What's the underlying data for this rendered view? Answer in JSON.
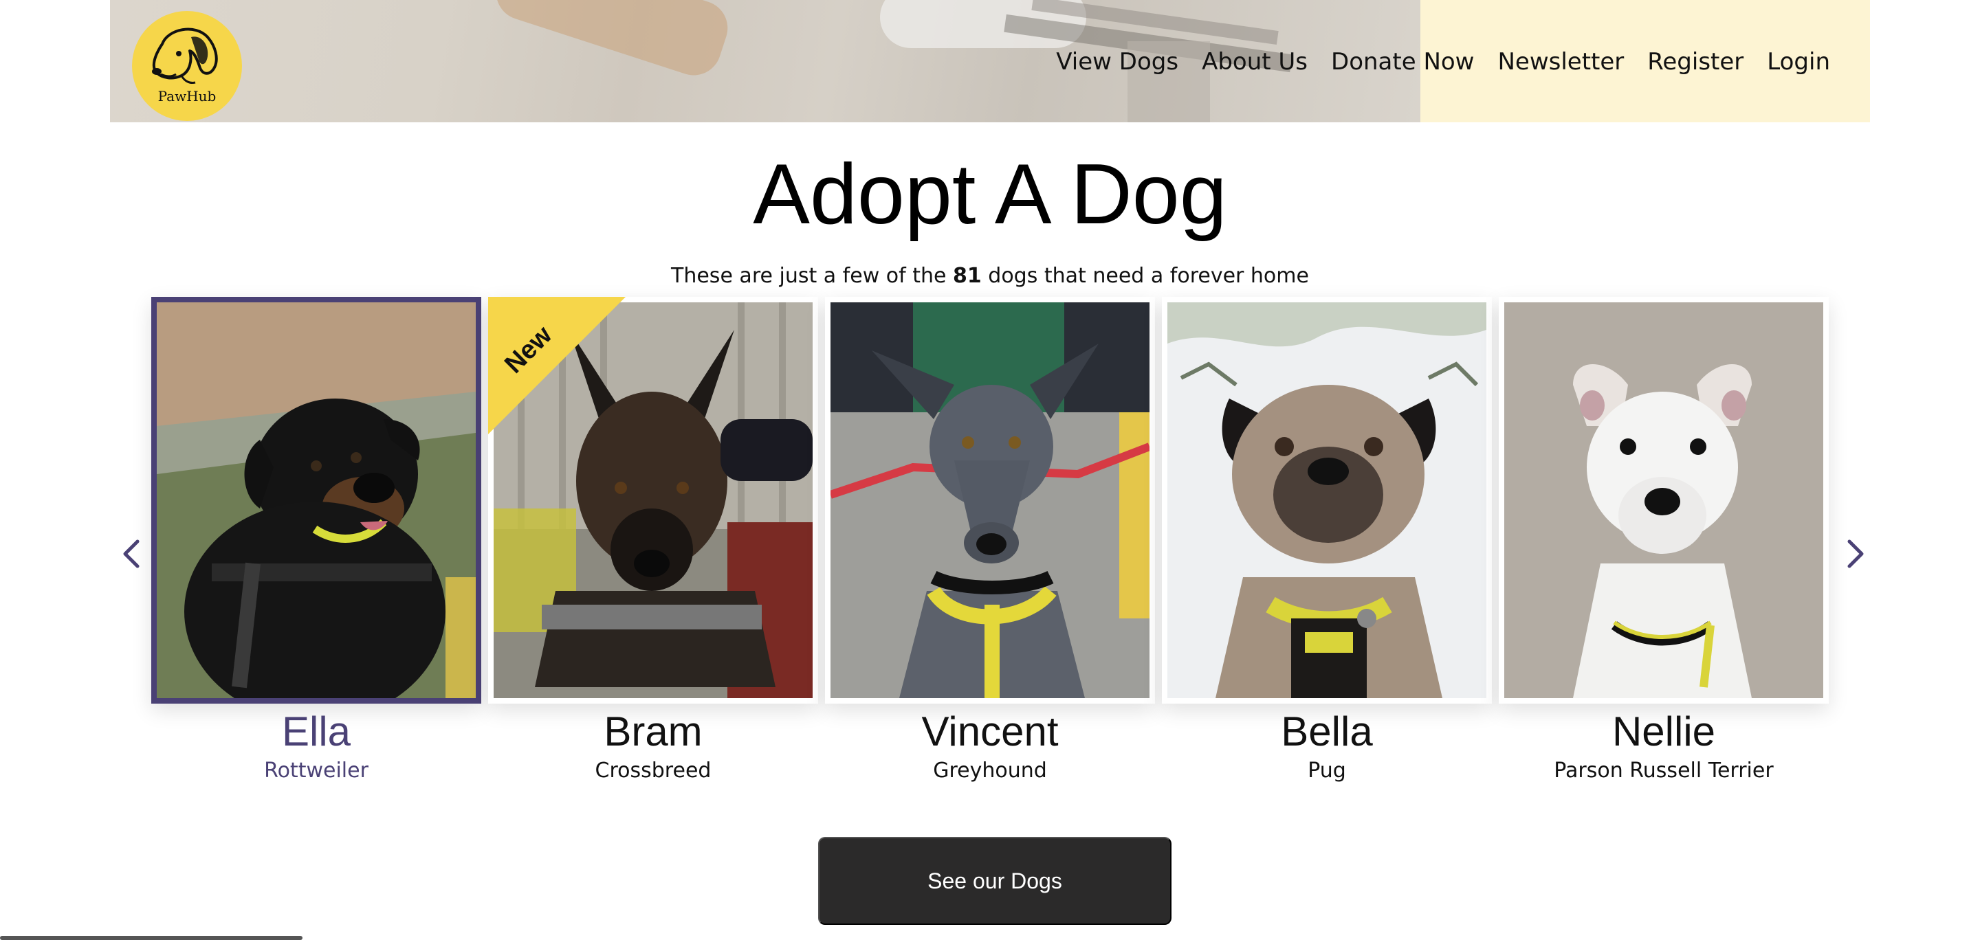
{
  "header": {
    "logo_text": "PawHub",
    "nav": [
      "View Dogs",
      "About Us",
      "Donate Now",
      "Newsletter",
      "Register",
      "Login"
    ]
  },
  "main": {
    "title": "Adopt A Dog",
    "subtitle_prefix": "These are just a few of the ",
    "dog_count": "81",
    "subtitle_suffix": " dogs that need a forever home",
    "ribbon_label": "New",
    "cta_label": "See our Dogs"
  },
  "dogs": [
    {
      "name": "Ella",
      "breed": "Rottweiler",
      "selected": true
    },
    {
      "name": "Bram",
      "breed": "Crossbreed",
      "badge": "New"
    },
    {
      "name": "Vincent",
      "breed": "Greyhound"
    },
    {
      "name": "Bella",
      "breed": "Pug"
    },
    {
      "name": "Nellie",
      "breed": "Parson Russell Terrier"
    }
  ],
  "colors": {
    "accent": "#4a4175",
    "logo_yellow": "#f6d64a",
    "header_bg": "#fdf4d3",
    "button_bg": "#2b2a2a"
  },
  "icons": {
    "prev": "chevron-left-icon",
    "next": "chevron-right-icon",
    "logo": "dog-head-icon"
  }
}
